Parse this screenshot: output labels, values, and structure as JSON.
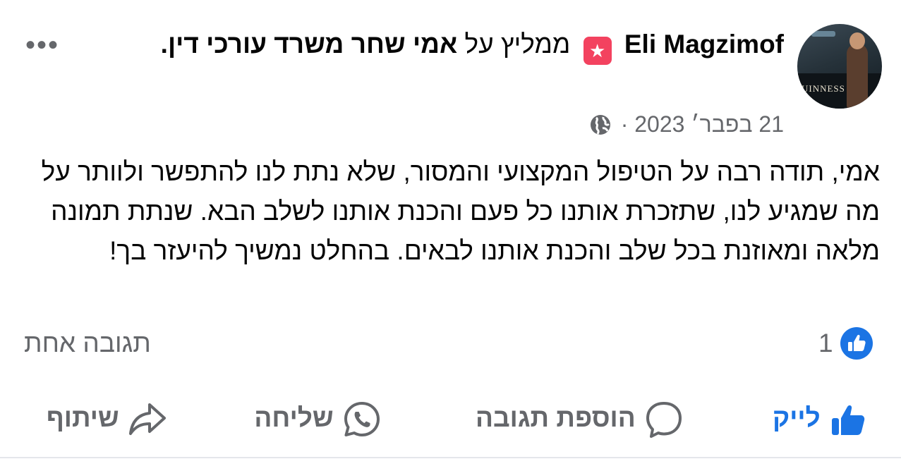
{
  "post": {
    "author": "Eli Magzimof",
    "recommends_text": "ממליץ על",
    "page_name": "אמי שחר משרד עורכי דין.",
    "date": "21 בפבר׳ 2023",
    "separator": "·",
    "more_label": "•••",
    "content": "אמי, תודה רבה על הטיפול המקצועי והמסור, שלא נתת לנו להתפשר ולוותר על מה שמגיע לנו, שתזכרת אותנו כל פעם והכנת אותנו לשלב הבא. שנתת תמונה מלאה ומאוזנת בכל שלב והכנת אותנו לבאים. בהחלט נמשיך להיעזר בך!",
    "avatar_sign": "UINNESS"
  },
  "reactions": {
    "like_count": "1",
    "comments_summary": "תגובה אחת"
  },
  "actions": {
    "like": "לייק",
    "comment": "הוספת תגובה",
    "send": "שליחה",
    "share": "שיתוף"
  },
  "colors": {
    "accent": "#1b74e4",
    "muted": "#65676b",
    "recommend_badge": "#f3425f"
  },
  "icons": {
    "recommend": "star-badge-icon",
    "privacy": "globe-icon",
    "like_reaction": "thumbs-up-icon",
    "comment": "speech-bubble-icon",
    "send": "whatsapp-icon",
    "share": "share-arrow-icon",
    "more": "more-dots-icon"
  }
}
